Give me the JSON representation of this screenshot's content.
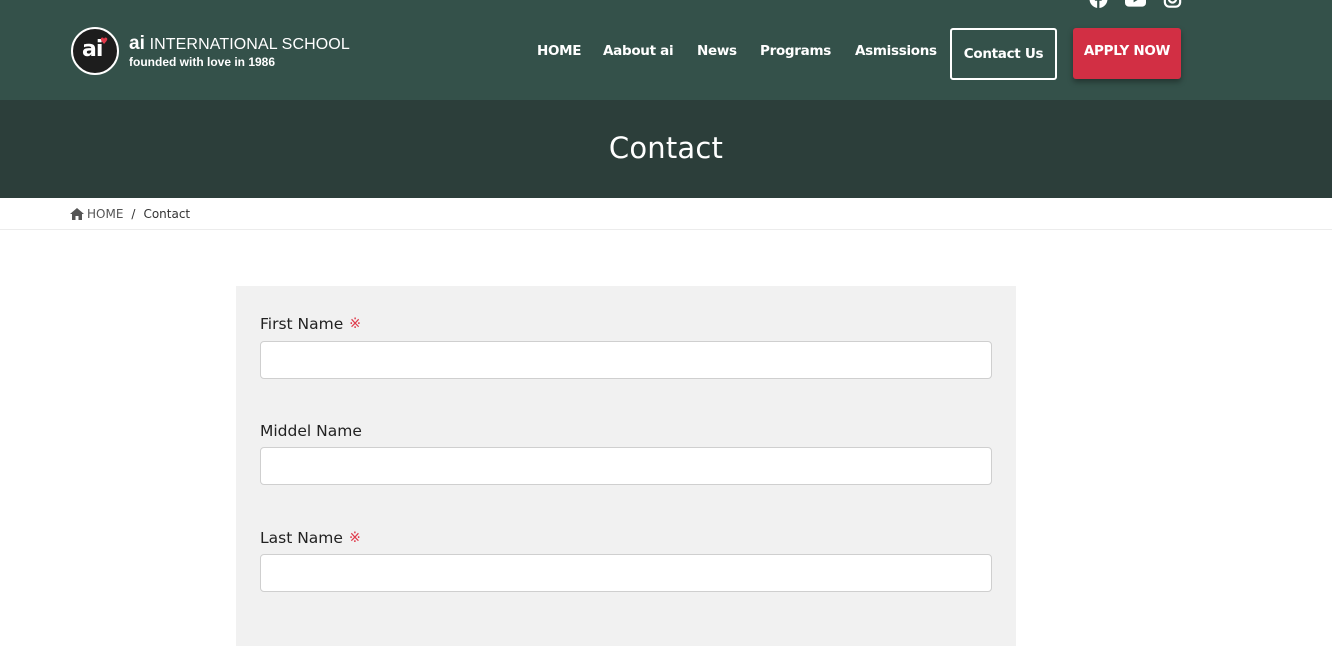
{
  "header": {
    "logo": {
      "mark": "ai",
      "title_prefix": "ai",
      "title_rest": " INTERNATIONAL SCHOOL",
      "subtitle": "founded with love in 1986"
    },
    "social_icons": [
      "facebook-icon",
      "youtube-icon",
      "instagram-icon"
    ],
    "nav": {
      "home": "HOME",
      "about": "Aabout ai",
      "news": "News",
      "programs": "Programs",
      "admissions": "Asmissions",
      "contact": "Contact Us"
    },
    "apply_label": "APPLY NOW"
  },
  "banner": {
    "title": "Contact"
  },
  "breadcrumb": {
    "home": "HOME",
    "separator": "/",
    "current": "Contact"
  },
  "form": {
    "required_marker": "※",
    "fields": [
      {
        "label": "First Name",
        "required": true,
        "value": ""
      },
      {
        "label": "Middel Name",
        "required": false,
        "value": ""
      },
      {
        "label": "Last Name",
        "required": true,
        "value": ""
      }
    ]
  },
  "colors": {
    "header_bg": "#34514a",
    "banner_bg": "#2c3e3a",
    "accent_red": "#d22f44",
    "form_bg": "#f1f1f1"
  }
}
